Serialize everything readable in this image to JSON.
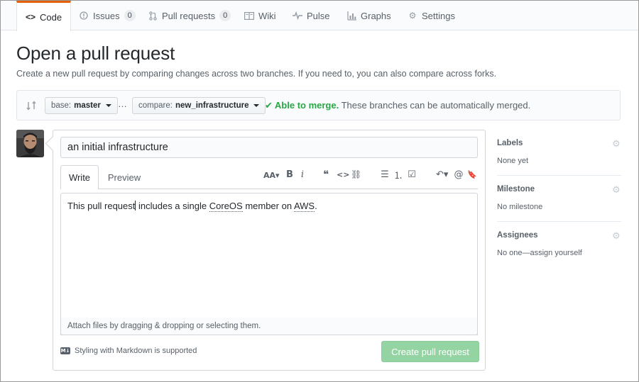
{
  "nav": {
    "tabs": [
      {
        "label": "Code",
        "icon": "code-icon",
        "selected": true
      },
      {
        "label": "Issues",
        "count": "0",
        "icon": "issue-icon"
      },
      {
        "label": "Pull requests",
        "count": "0",
        "icon": "pull-request-icon"
      },
      {
        "label": "Wiki",
        "icon": "book-icon"
      },
      {
        "label": "Pulse",
        "icon": "pulse-icon"
      },
      {
        "label": "Graphs",
        "icon": "graph-icon"
      },
      {
        "label": "Settings",
        "icon": "gear-icon"
      }
    ]
  },
  "page": {
    "title": "Open a pull request",
    "subtitle": "Create a new pull request by comparing changes across two branches. If you need to, you can also compare across forks."
  },
  "compare": {
    "base_prefix": "base:",
    "base_branch": "master",
    "separator": "…",
    "compare_prefix": "compare:",
    "compare_branch": "new_infrastructure",
    "merge_check": "✔",
    "merge_status": "Able to merge.",
    "merge_detail": "These branches can be automatically merged."
  },
  "form": {
    "title_value": "an initial infrastructure",
    "tab_write": "Write",
    "tab_preview": "Preview",
    "toolbar": [
      "AA▾",
      "B",
      "i",
      "❝",
      "<>",
      "⛓",
      "☰",
      "⒈",
      "☑",
      "↶▾",
      "@",
      "🔖"
    ],
    "body_part1": "This pull request",
    "body_part2": " includes a single ",
    "body_term1": "CoreOS",
    "body_part3": " member on ",
    "body_term2": "AWS",
    "body_part4": ".",
    "attach_text": "Attach files by dragging & dropping or selecting them.",
    "md_icon": "M↓",
    "markdown_note": "Styling with Markdown is supported",
    "submit_label": "Create pull request"
  },
  "sidebar": {
    "sections": [
      {
        "heading": "Labels",
        "value": "None yet"
      },
      {
        "heading": "Milestone",
        "value": "No milestone"
      },
      {
        "heading": "Assignees",
        "value": "No one—assign yourself"
      }
    ]
  },
  "colors": {
    "accent_tab": "#e36209",
    "merge_ok": "#28a745",
    "button_disabled_green": "#94d3a2"
  }
}
